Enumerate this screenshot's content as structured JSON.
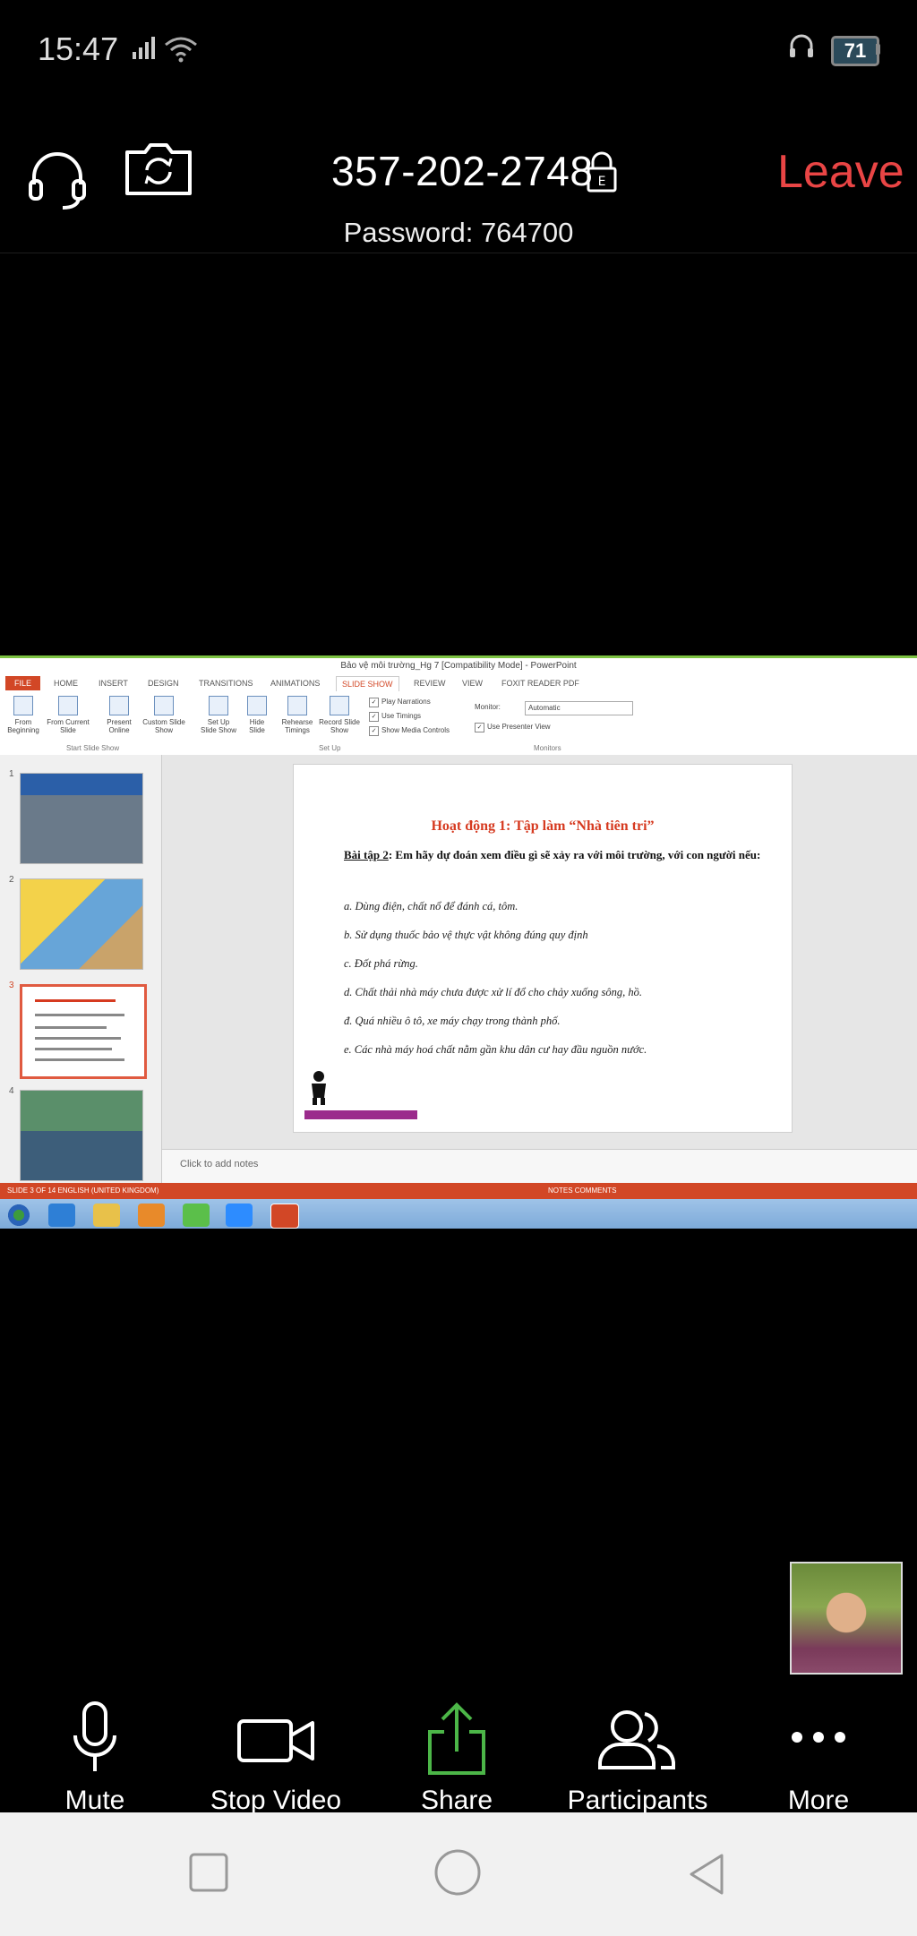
{
  "status_bar": {
    "time": "15:47",
    "battery": "71"
  },
  "meeting": {
    "id": "357-202-2748",
    "leave_label": "Leave",
    "password": "Password: 764700"
  },
  "shared_screen": {
    "window_title": "Bảo vệ môi trường_Hg 7 [Compatibility Mode] - PowerPoint",
    "tabs": [
      "FILE",
      "HOME",
      "INSERT",
      "DESIGN",
      "TRANSITIONS",
      "ANIMATIONS",
      "SLIDE SHOW",
      "REVIEW",
      "VIEW",
      "FOXIT READER PDF"
    ],
    "ribbon_buttons": [
      "From Beginning",
      "From Current Slide",
      "Present Online",
      "Custom Slide Show",
      "Set Up Slide Show",
      "Hide Slide",
      "Rehearse Timings",
      "Record Slide Show"
    ],
    "ribbon_checks": [
      "Play Narrations",
      "Use Timings",
      "Show Media Controls",
      "Use Presenter View"
    ],
    "monitor_label": "Monitor:",
    "monitor_value": "Automatic",
    "groups": [
      "Start Slide Show",
      "Set Up",
      "Monitors"
    ],
    "slide_numbers": [
      "1",
      "2",
      "3",
      "4"
    ],
    "slide": {
      "title": "Hoạt động 1: Tập làm “Nhà tiên tri”",
      "task_label": "Bài tập 2",
      "task_text": ": Em hãy dự đoán xem điều gì sẽ xảy ra với môi trường, với con người nếu:",
      "items": [
        "a. Dùng điện, chất nổ để đánh cá, tôm.",
        "b. Sử dụng thuốc bảo vệ thực vật không đúng quy định",
        "c. Đốt phá rừng.",
        "d. Chất thải nhà máy chưa được xử lí đổ cho chảy xuống sông, hồ.",
        "đ. Quá nhiều ô tô, xe máy chạy trong thành phố.",
        "e. Các nhà máy hoá chất nằm gần khu dân cư hay đầu nguồn nước."
      ]
    },
    "notes_placeholder": "Click to add notes",
    "status_left": "SLIDE 3 OF 14    ENGLISH (UNITED KINGDOM)",
    "status_right": "NOTES    COMMENTS"
  },
  "toolbar": {
    "mute": "Mute",
    "stop_video": "Stop Video",
    "share": "Share",
    "participants": "Participants",
    "more": "More"
  },
  "colors": {
    "leave": "#e94545",
    "share_green": "#4cb648",
    "accent_orange": "#d24726"
  }
}
